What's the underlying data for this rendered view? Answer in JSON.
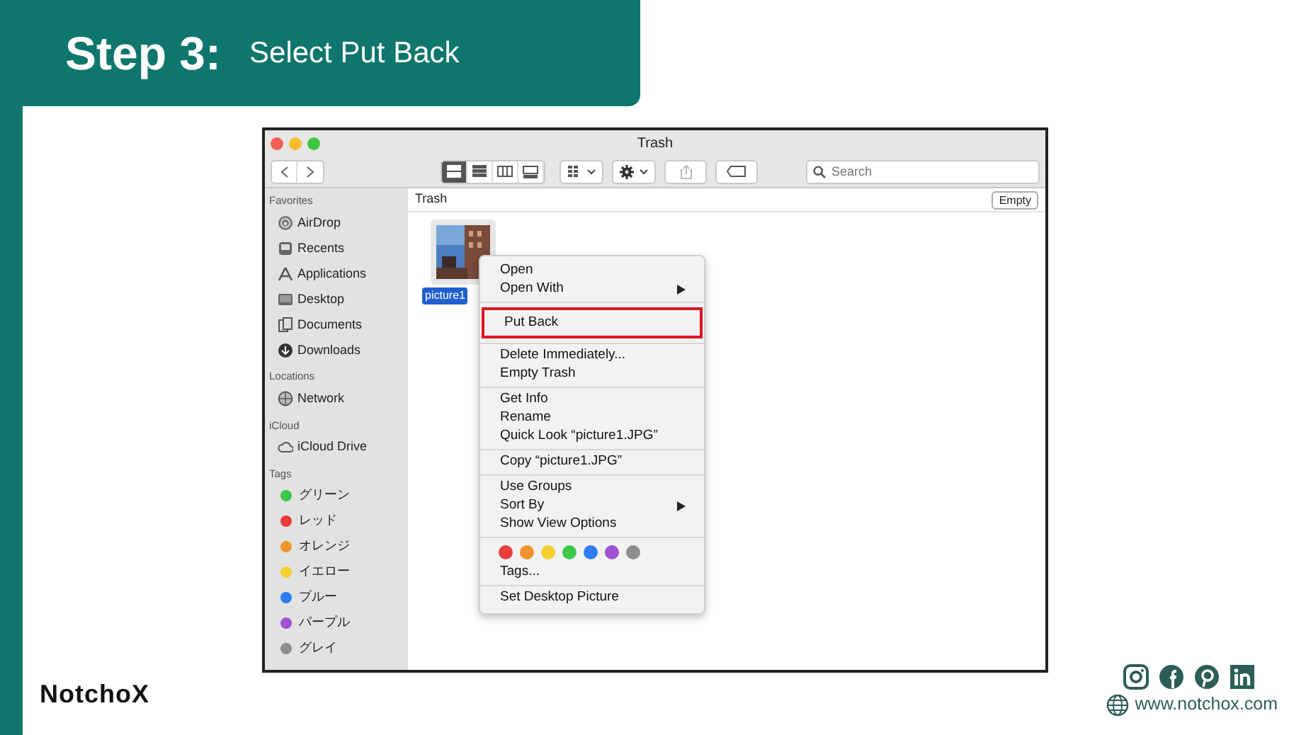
{
  "slide": {
    "step": "Step 3:",
    "title": "Select Put Back"
  },
  "window": {
    "title": "Trash",
    "view_modes": [
      {
        "kind": "icons",
        "selected": true
      },
      {
        "kind": "list",
        "selected": false
      },
      {
        "kind": "columns",
        "selected": false
      },
      {
        "kind": "gallery",
        "selected": false
      }
    ],
    "search": {
      "placeholder": "Search"
    },
    "path_label": "Trash",
    "empty_button": "Empty"
  },
  "sidebar": [
    {
      "heading": "Favorites",
      "items": [
        {
          "label": "AirDrop",
          "kind": "airdrop"
        },
        {
          "label": "Recents",
          "kind": "recents"
        },
        {
          "label": "Applications",
          "kind": "apps"
        },
        {
          "label": "Desktop",
          "kind": "desktop"
        },
        {
          "label": "Documents",
          "kind": "documents"
        },
        {
          "label": "Downloads",
          "kind": "downloads"
        }
      ]
    },
    {
      "heading": "Locations",
      "items": [
        {
          "label": "Network",
          "kind": "network"
        }
      ]
    },
    {
      "heading": "iCloud",
      "items": [
        {
          "label": "iCloud Drive",
          "kind": "cloud"
        }
      ]
    },
    {
      "heading": "Tags",
      "items": [
        {
          "label": "グリーン",
          "kind": "tag",
          "color": "#3ec64a"
        },
        {
          "label": "レッド",
          "kind": "tag",
          "color": "#ea3c3c"
        },
        {
          "label": "オレンジ",
          "kind": "tag",
          "color": "#f0952e"
        },
        {
          "label": "イエロー",
          "kind": "tag",
          "color": "#f5cf2f"
        },
        {
          "label": "ブルー",
          "kind": "tag",
          "color": "#2f7cf0"
        },
        {
          "label": "パープル",
          "kind": "tag",
          "color": "#a050d0"
        },
        {
          "label": "グレイ",
          "kind": "tag",
          "color": "#8e8e8e"
        }
      ]
    }
  ],
  "file": {
    "label": "picture1",
    "selected": true
  },
  "context_menu": [
    [
      {
        "kind": "item",
        "label": "Open"
      },
      {
        "kind": "item",
        "label": "Open With",
        "submenu": true
      }
    ],
    [
      {
        "kind": "item",
        "label": "Put Back",
        "highlighted": true
      }
    ],
    [
      {
        "kind": "item",
        "label": "Delete Immediately..."
      },
      {
        "kind": "item",
        "label": "Empty Trash"
      }
    ],
    [
      {
        "kind": "item",
        "label": "Get Info"
      },
      {
        "kind": "item",
        "label": "Rename"
      },
      {
        "kind": "item",
        "label": "Quick Look “picture1.JPG”"
      }
    ],
    [
      {
        "kind": "item",
        "label": "Copy “picture1.JPG”"
      }
    ],
    [
      {
        "kind": "item",
        "label": "Use Groups"
      },
      {
        "kind": "item",
        "label": "Sort By",
        "submenu": true
      },
      {
        "kind": "item",
        "label": "Show View Options"
      }
    ],
    [
      {
        "kind": "tags",
        "colors": [
          {
            "color": "#ea3c3c"
          },
          {
            "color": "#f0952e"
          },
          {
            "color": "#f5cf2f"
          },
          {
            "color": "#3ec64a"
          },
          {
            "color": "#2f7cf0"
          },
          {
            "color": "#a050d0"
          },
          {
            "color": "#8e8e8e"
          }
        ]
      },
      {
        "kind": "item",
        "label": "Tags..."
      }
    ],
    [
      {
        "kind": "item",
        "label": "Set Desktop Picture"
      }
    ]
  ],
  "footer": {
    "logo": "NotchoX",
    "socials": [
      {
        "kind": "instagram"
      },
      {
        "kind": "facebook"
      },
      {
        "kind": "pinterest"
      },
      {
        "kind": "linkedin"
      }
    ],
    "url": "www.notchox.com"
  }
}
